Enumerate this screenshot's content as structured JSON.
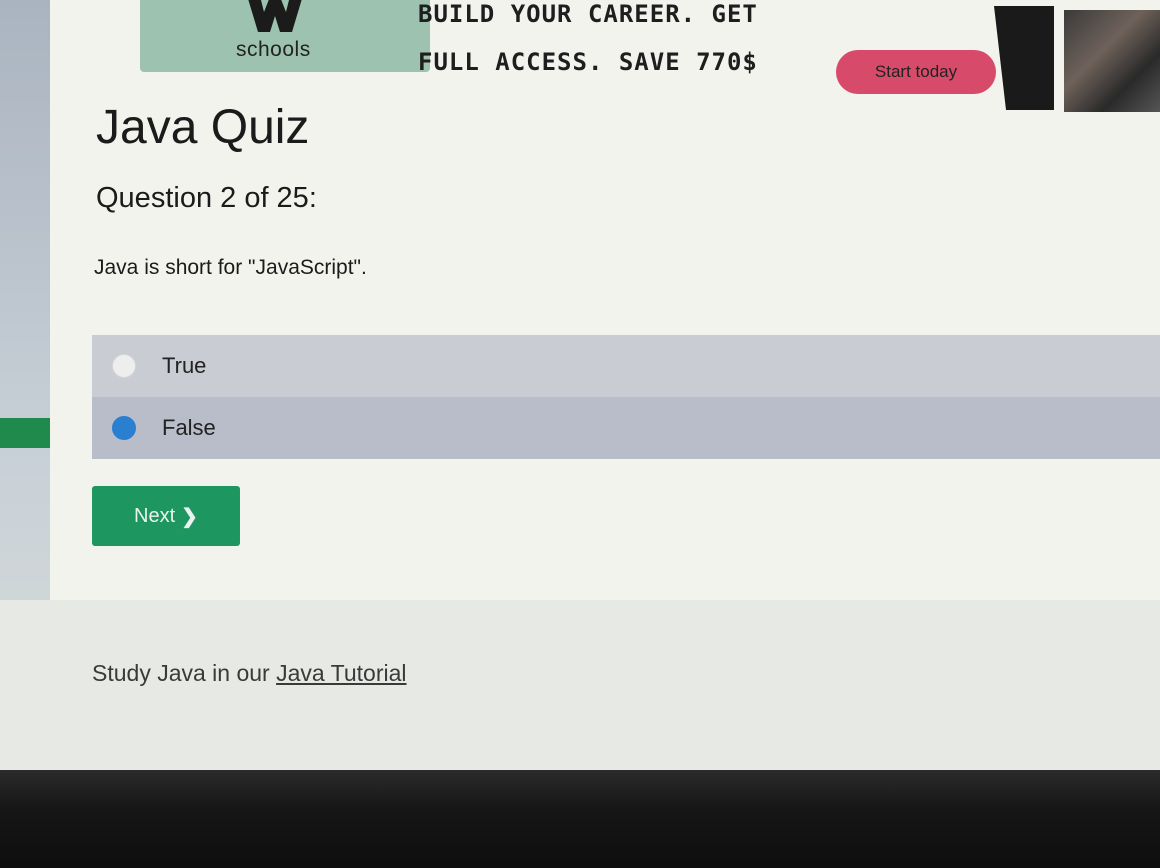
{
  "ad": {
    "logo_text": "schools",
    "headline_line1": "BUILD YOUR CAREER. GET",
    "headline_line2": "FULL ACCESS. SAVE 770$",
    "cta_label": "Start today",
    "cta_color": "#d84a6a"
  },
  "quiz": {
    "title": "Java Quiz",
    "question_number": "Question 2 of 25:",
    "question_text": "Java is short for \"JavaScript\".",
    "options": [
      {
        "label": "True",
        "selected": false
      },
      {
        "label": "False",
        "selected": true
      }
    ],
    "next_label": "Next",
    "next_icon": "chevron-right-icon",
    "accent_color": "#1e9660"
  },
  "footer": {
    "study_text": "Study Java in our ",
    "tutorial_link": "Java Tutorial"
  }
}
